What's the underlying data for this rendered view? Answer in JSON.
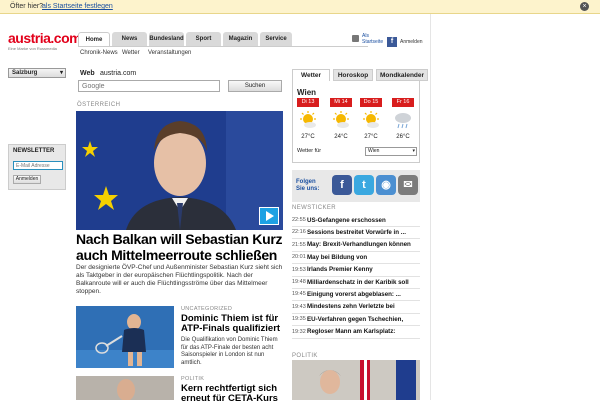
{
  "notification": {
    "question": "Öfter hier?",
    "link": "als Startseite festlegen",
    "close": "×"
  },
  "logo": {
    "brand": "austria.com",
    "tagline": "Eine Marke von Russmedia"
  },
  "nav": {
    "tabs": [
      "Home",
      "News",
      "Bundesland",
      "Sport",
      "Magazin",
      "Service"
    ],
    "active": 0
  },
  "subnav": [
    "Chronik-News",
    "Wetter",
    "Veranstaltungen"
  ],
  "header_right": {
    "als": "Als",
    "startseite": "Startseite",
    "anmelden": "Anmelden",
    "fb": "f"
  },
  "region": {
    "selected": "Salzburg"
  },
  "newsletter": {
    "title": "NEWSLETTER",
    "placeholder": "E-Mail Adresse",
    "button": "Anmelden"
  },
  "search": {
    "tab_web": "Web",
    "tab_site": "austria.com",
    "placeholder": "Google",
    "button": "Suchen"
  },
  "hero": {
    "section": "ÖSTERREICH",
    "title": "Nach Balkan will Sebastian Kurz auch Mittelmeerroute schließen",
    "lead": "Der designierte ÖVP-Chef und Außenminister Sebastian Kurz sieht sich als Taktgeber in der europäischen Flüchtlingspolitik. Nach der Balkanroute will er auch die Flüchtlingsströme über das Mittelmeer stoppen."
  },
  "articles": [
    {
      "category": "UNCATEGORIZED",
      "title": "Dominic Thiem ist für ATP-Finals qualifiziert",
      "lead": "Die Qualifikation von Dominic Thiem für das ATP-Finale der besten acht Saisonspieler in London ist nun amtlich."
    },
    {
      "category": "POLITIK",
      "title": "Kern rechtfertigt sich erneut für CETA-Kurs"
    }
  ],
  "weather": {
    "tabs": [
      "Wetter",
      "Horoskop",
      "Mondkalender"
    ],
    "city": "Wien",
    "days": [
      {
        "day": "Di 13",
        "temp": "27°C",
        "icon": "sun-cloud-icon"
      },
      {
        "day": "Mi 14",
        "temp": "24°C",
        "icon": "sun-cloud-icon"
      },
      {
        "day": "Do 15",
        "temp": "27°C",
        "icon": "sun-cloud-icon"
      },
      {
        "day": "Fr 16",
        "temp": "26°C",
        "icon": "cloud-rain-icon"
      }
    ],
    "for_label": "Wetter für",
    "select": "Wien"
  },
  "social": {
    "title": "Folgen Sie uns:"
  },
  "newsticker": {
    "title": "NEWSTICKER",
    "items": [
      {
        "time": "22:55",
        "text": "US-Gefangene erschossen"
      },
      {
        "time": "22:16",
        "text": "Sessions bestreitet Vorwürfe in ..."
      },
      {
        "time": "21:55",
        "text": "May: Brexit-Verhandlungen können"
      },
      {
        "time": "20:01",
        "text": "May bei Bildung von"
      },
      {
        "time": "19:53",
        "text": "Irlands Premier Kenny"
      },
      {
        "time": "19:48",
        "text": "Milliardenschatz in der Karibik soll"
      },
      {
        "time": "19:45",
        "text": "Einigung vorerst abgeblasen: ..."
      },
      {
        "time": "19:43",
        "text": "Mindestens zehn Verletzte bei"
      },
      {
        "time": "19:35",
        "text": "EU-Verfahren gegen Tschechien,"
      },
      {
        "time": "19:32",
        "text": "Regloser Mann am Karlsplatz:"
      }
    ]
  },
  "politik_label": "POLITIK",
  "colors": {
    "brand": "#e2001a",
    "day_badge": "#d81d1d",
    "link": "#1a4fa0"
  }
}
